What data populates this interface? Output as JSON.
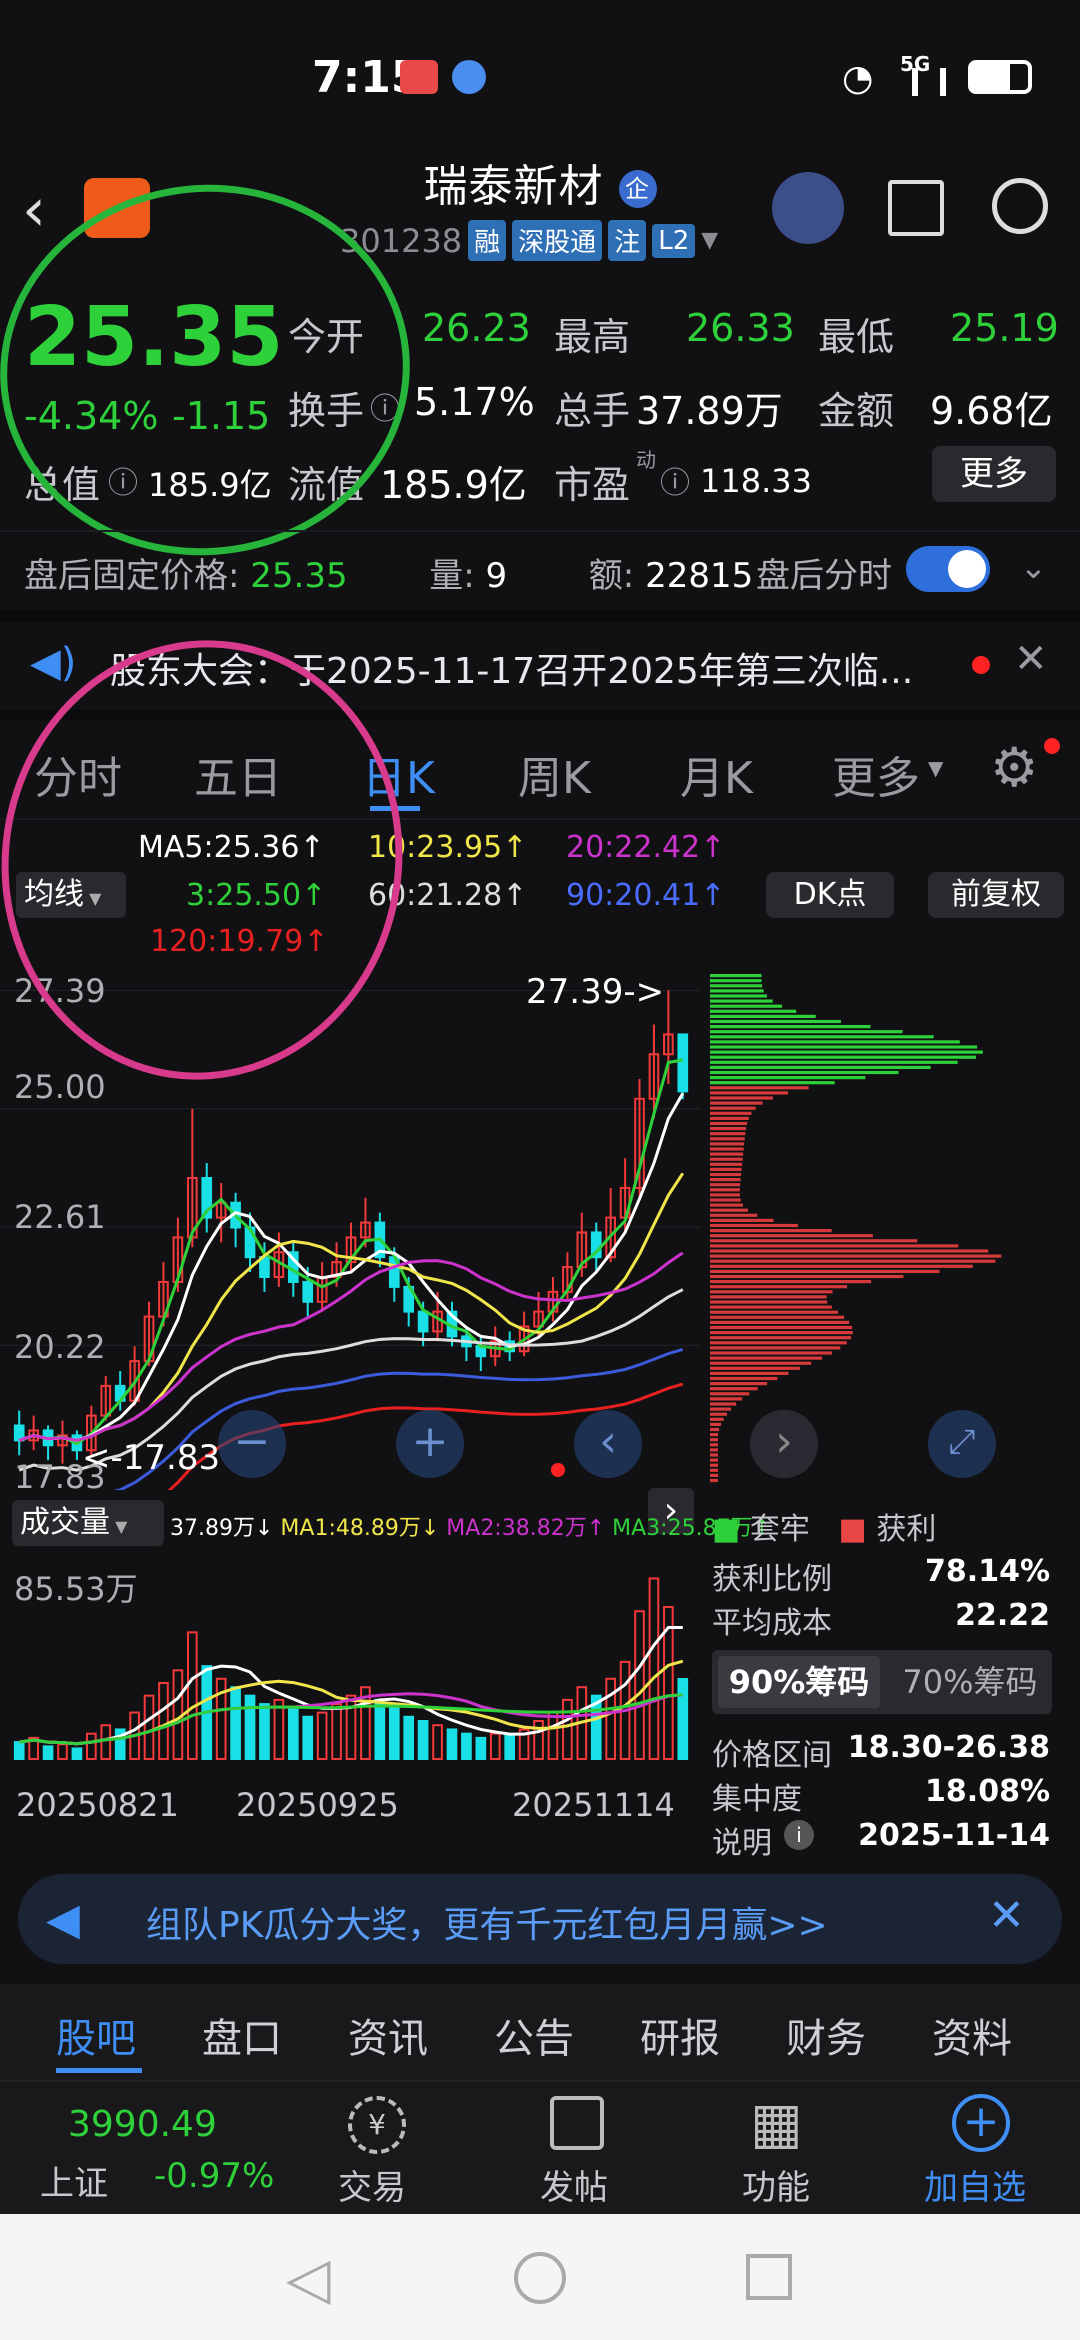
{
  "status": {
    "time": "7:15",
    "network": "5G"
  },
  "header": {
    "stock_name": "瑞泰新材",
    "badge": "企",
    "code": "301238",
    "tags": [
      "融",
      "深股通",
      "注",
      "L2"
    ]
  },
  "quote": {
    "price": "25.35",
    "change_pct": "-4.34%",
    "change": "-1.15",
    "market_cap_label": "总值",
    "market_cap": "185.9亿",
    "open_label": "今开",
    "open": "26.23",
    "high_label": "最高",
    "high": "26.33",
    "low_label": "最低",
    "low": "25.19",
    "turnover_label": "换手",
    "turnover": "5.17%",
    "vol_label": "总手",
    "vol": "37.89万",
    "amount_label": "金额",
    "amount": "9.68亿",
    "float_label": "流值",
    "float_cap": "185.9亿",
    "pe_label": "市盈",
    "pe_sup": "动",
    "pe": "118.33",
    "more": "更多"
  },
  "after_hours": {
    "price_label": "盘后固定价格:",
    "price": "25.35",
    "vol_label": "量:",
    "vol": "9",
    "amt_label": "额:",
    "amt": "22815",
    "fenshi_label": "盘后分时"
  },
  "notice": {
    "text": "股东大会：于2025-11-17召开2025年第三次临..."
  },
  "tabs": [
    "分时",
    "五日",
    "日K",
    "周K",
    "月K",
    "更多"
  ],
  "ma": {
    "selector": "均线",
    "ma5": "MA5:25.36↑",
    "ma10": "10:23.95↑",
    "ma20": "20:22.42↑",
    "ma3": "3:25.50↑",
    "ma60": "60:21.28↑",
    "ma90": "90:20.41↑",
    "ma120": "120:19.79↑",
    "dk": "DK点",
    "fq": "前复权"
  },
  "colors": {
    "up": "#f23a3a",
    "down": "#2fd13a",
    "accent": "#3f8ef5",
    "ma5": "#ffffff",
    "ma10": "#f0e64a",
    "ma20": "#cc33cc",
    "ma60": "#dddddd",
    "ma90": "#3b5bdb",
    "ma120": "#e82020",
    "vol_bar": "#19e0e6"
  },
  "chart_data": {
    "type": "candlestick",
    "y_ticks": [
      "27.39",
      "25.00",
      "22.61",
      "20.22",
      "17.83"
    ],
    "high_label": "27.39->",
    "low_label": "<-17.83",
    "x_labels": [
      "20250821",
      "20250925",
      "20251114"
    ],
    "candles": [
      [
        18.6,
        18.3,
        18.9,
        18.0
      ],
      [
        18.3,
        18.5,
        18.8,
        18.1
      ],
      [
        18.5,
        18.2,
        18.6,
        17.9
      ],
      [
        18.2,
        18.4,
        18.7,
        17.83
      ],
      [
        18.4,
        18.1,
        18.5,
        17.9
      ],
      [
        18.1,
        18.8,
        19.0,
        18.0
      ],
      [
        18.8,
        19.4,
        19.6,
        18.7
      ],
      [
        19.4,
        19.1,
        19.7,
        18.9
      ],
      [
        19.1,
        19.9,
        20.2,
        19.0
      ],
      [
        19.9,
        20.8,
        21.1,
        19.8
      ],
      [
        20.8,
        21.5,
        21.9,
        20.6
      ],
      [
        21.5,
        22.4,
        22.8,
        21.3
      ],
      [
        22.4,
        23.6,
        25.0,
        22.2
      ],
      [
        23.6,
        22.8,
        23.9,
        22.5
      ],
      [
        22.8,
        23.1,
        23.5,
        22.3
      ],
      [
        23.1,
        22.6,
        23.3,
        22.2
      ],
      [
        22.6,
        22.0,
        22.9,
        21.7
      ],
      [
        22.0,
        21.6,
        22.3,
        21.3
      ],
      [
        21.6,
        22.1,
        22.5,
        21.4
      ],
      [
        22.1,
        21.5,
        22.3,
        21.2
      ],
      [
        21.5,
        21.1,
        21.8,
        20.8
      ],
      [
        21.1,
        21.6,
        21.9,
        20.9
      ],
      [
        21.6,
        21.9,
        22.3,
        21.4
      ],
      [
        21.9,
        22.4,
        22.7,
        21.7
      ],
      [
        22.4,
        22.7,
        23.2,
        22.2
      ],
      [
        22.7,
        22.0,
        22.9,
        21.8
      ],
      [
        22.0,
        21.4,
        22.2,
        21.1
      ],
      [
        21.4,
        20.9,
        21.6,
        20.6
      ],
      [
        20.9,
        20.5,
        21.1,
        20.2
      ],
      [
        20.5,
        20.9,
        21.3,
        20.3
      ],
      [
        20.9,
        20.4,
        21.1,
        20.2
      ],
      [
        20.4,
        20.2,
        20.6,
        19.9
      ],
      [
        20.2,
        20.0,
        20.4,
        19.7
      ],
      [
        20.0,
        20.3,
        20.6,
        19.8
      ],
      [
        20.3,
        20.1,
        20.5,
        19.9
      ],
      [
        20.1,
        20.6,
        20.9,
        20.0
      ],
      [
        20.6,
        20.9,
        21.3,
        20.4
      ],
      [
        20.9,
        21.3,
        21.6,
        20.7
      ],
      [
        21.3,
        21.8,
        22.1,
        21.1
      ],
      [
        21.8,
        22.5,
        22.9,
        21.6
      ],
      [
        22.5,
        22.0,
        22.7,
        21.7
      ],
      [
        22.0,
        22.8,
        23.4,
        21.9
      ],
      [
        22.8,
        23.4,
        24.0,
        22.5
      ],
      [
        23.4,
        25.2,
        25.6,
        23.2
      ],
      [
        25.2,
        26.1,
        26.7,
        24.8
      ],
      [
        26.1,
        26.5,
        27.39,
        25.5
      ],
      [
        26.5,
        25.35,
        26.33,
        25.19
      ]
    ],
    "volumes": [
      8,
      10,
      6,
      7,
      5,
      12,
      16,
      14,
      22,
      30,
      36,
      42,
      60,
      44,
      38,
      34,
      30,
      26,
      28,
      24,
      20,
      22,
      26,
      30,
      34,
      28,
      24,
      20,
      18,
      16,
      14,
      12,
      10,
      12,
      11,
      14,
      18,
      22,
      28,
      34,
      30,
      38,
      46,
      70,
      85.53,
      72,
      37.89
    ],
    "vol_top_label": "85.53万",
    "vol_selector": "成交量",
    "vol_ma": "37.89万↓",
    "vol_ma1": "MA1:48.89万↓",
    "vol_ma2": "MA2:38.82万↑",
    "vol_ma3": "MA3:25.87万↑"
  },
  "chips": {
    "legend_trapped": "套牢",
    "legend_profit": "获利",
    "profit_ratio_label": "获利比例",
    "profit_ratio": "78.14%",
    "avg_cost_label": "平均成本",
    "avg_cost": "22.22",
    "tab90": "90%筹码",
    "tab70": "70%筹码",
    "range_label": "价格区间",
    "range": "18.30-26.38",
    "concentration_label": "集中度",
    "concentration": "18.08%",
    "desc_label": "说明",
    "date": "2025-11-14"
  },
  "promo": {
    "text": "组队PK瓜分大奖，更有千元红包月月赢>>"
  },
  "nav_tabs": [
    "股吧",
    "盘口",
    "资讯",
    "公告",
    "研报",
    "财务",
    "资料"
  ],
  "bottom": {
    "index_value": "3990.49",
    "index_name": "上证",
    "index_change": "-0.97%",
    "trade": "交易",
    "post": "发帖",
    "func": "功能",
    "add": "加自选"
  }
}
